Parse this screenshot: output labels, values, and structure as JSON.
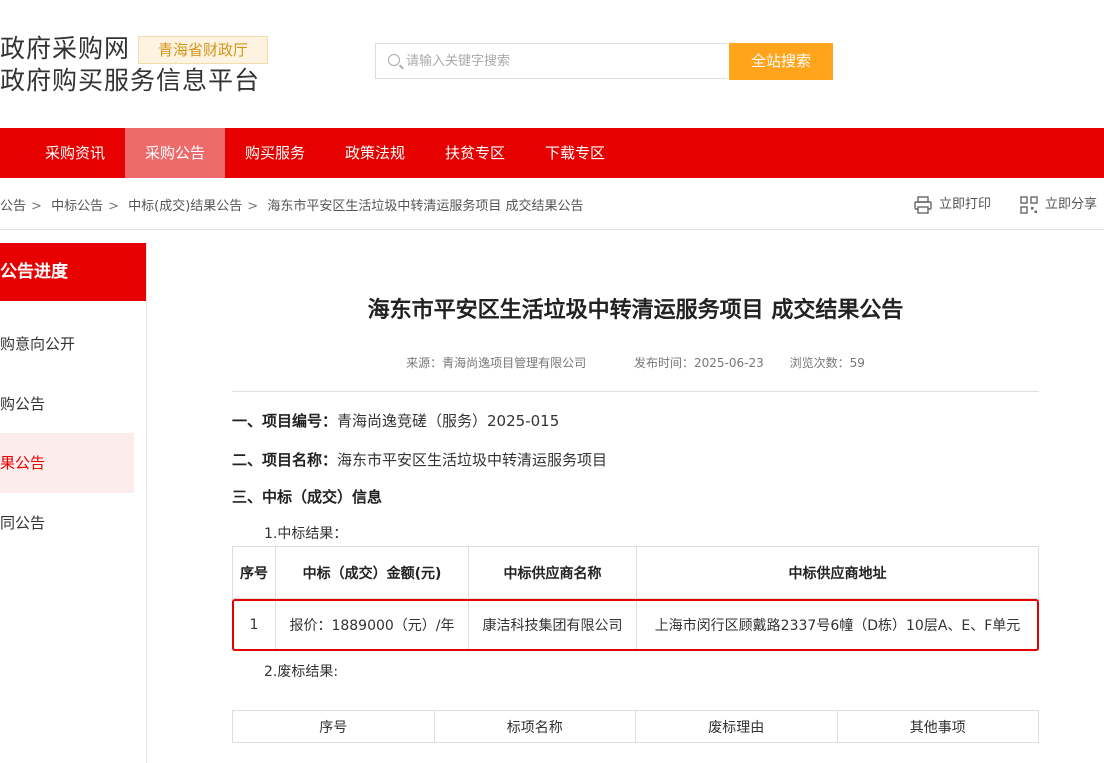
{
  "header": {
    "title_line1": "政府采购网",
    "title_line2": "政府购买服务信息平台",
    "badge": "青海省财政厅",
    "search_placeholder": "请输入关键字搜索",
    "search_button": "全站搜索"
  },
  "nav": [
    "采购资讯",
    "采购公告",
    "购买服务",
    "政策法规",
    "扶贫专区",
    "下载专区"
  ],
  "breadcrumb": [
    "公告",
    "中标公告",
    "中标(成交)结果公告",
    "海东市平安区生活垃圾中转清运服务项目 成交结果公告"
  ],
  "tools": {
    "print": "立即打印",
    "share": "立即分享"
  },
  "sidebar": {
    "header": "公告进度",
    "items": [
      "购意向公开",
      "购公告",
      "果公告",
      "同公告"
    ]
  },
  "article": {
    "title": "海东市平安区生活垃圾中转清运服务项目 成交结果公告",
    "source": "来源：青海尚逸项目管理有限公司",
    "publish": "发布时间：2025-06-23",
    "views": "浏览次数：59",
    "s1_label": "一、项目编号：",
    "s1_value": "青海尚逸竞磋（服务）2025-015",
    "s2_label": "二、项目名称：",
    "s2_value": "海东市平安区生活垃圾中转清运服务项目",
    "s3_label": "三、中标（成交）信息",
    "sub1": "1.中标结果：",
    "table1": {
      "headers": [
        "序号",
        "中标（成交）金额(元)",
        "中标供应商名称",
        "中标供应商地址"
      ],
      "rows": [
        [
          "1",
          "报价：1889000（元）/年",
          "康洁科技集团有限公司",
          "上海市闵行区顾戴路2337号6幢（D栋）10层A、E、F单元"
        ]
      ]
    },
    "sub2": "2.废标结果:",
    "table2": {
      "headers": [
        "序号",
        "标项名称",
        "废标理由",
        "其他事项"
      ]
    }
  }
}
